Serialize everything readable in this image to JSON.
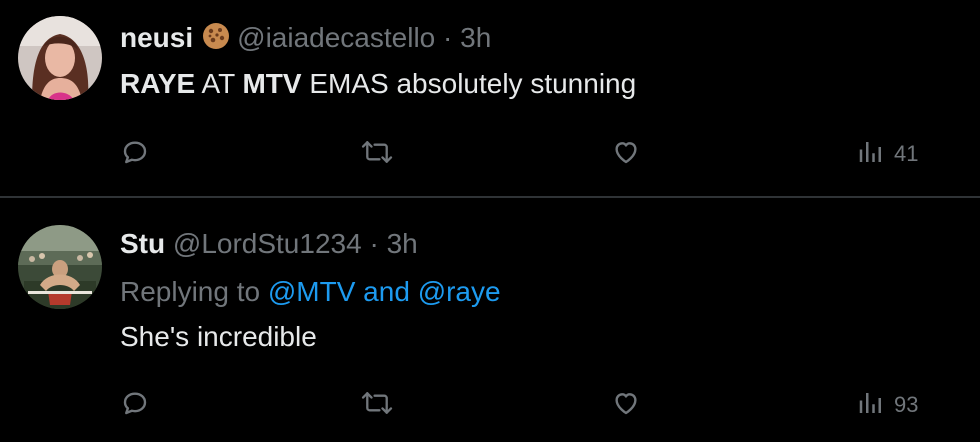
{
  "tweets": [
    {
      "author": {
        "name": "neusi",
        "handle": "@iaiadecastello",
        "badge_icon": "cookie-emoji"
      },
      "separator": "·",
      "time": "3h",
      "text": {
        "part1": "RAYE",
        "part2": " AT ",
        "part3": "MTV",
        "part4": " EMAS absolutely stunning"
      },
      "views": "41"
    },
    {
      "author": {
        "name": "Stu",
        "handle": "@LordStu1234"
      },
      "separator": "·",
      "time": "3h",
      "replying": {
        "prefix": "Replying to ",
        "mention1": "@MTV",
        "conj": " and ",
        "mention2": "@raye"
      },
      "text": {
        "body": "She's incredible"
      },
      "views": "93"
    }
  ],
  "colors": {
    "background": "#000000",
    "text": "#e7e9ea",
    "muted": "#71767b",
    "accent": "#1d9bf0",
    "divider": "#2f3336"
  },
  "icons": [
    "reply-icon",
    "retweet-icon",
    "like-icon",
    "views-icon"
  ]
}
